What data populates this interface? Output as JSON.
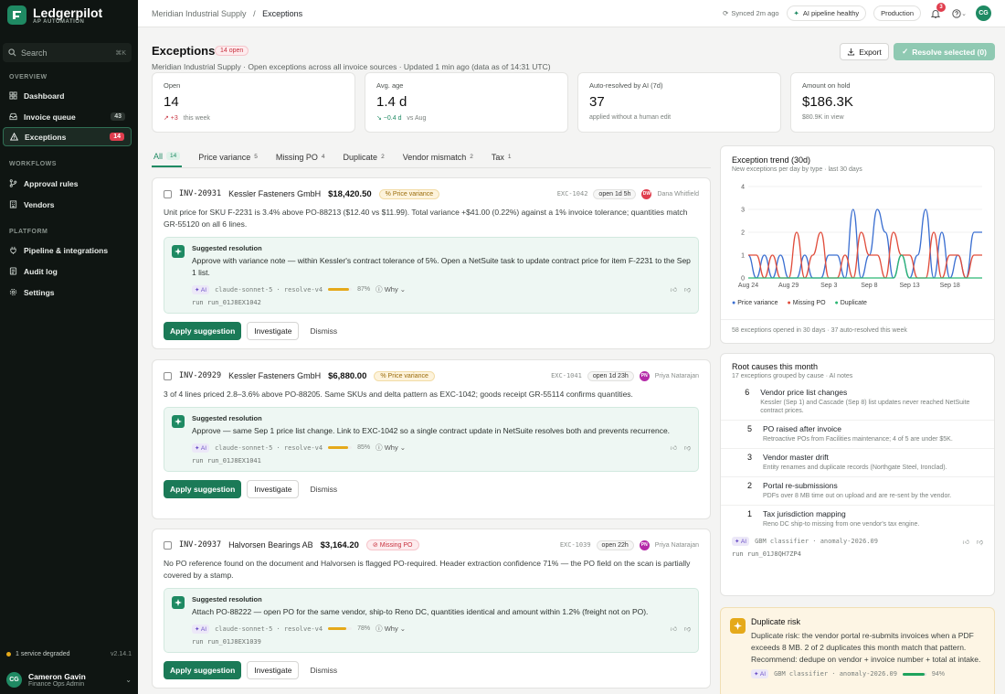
{
  "brand": {
    "name": "Ledgerpilot",
    "subtitle": "AP AUTOMATION"
  },
  "sidebar": {
    "search_placeholder": "Search",
    "search_shortcut": "⌘K",
    "sections": {
      "overview": "OVERVIEW",
      "workflows": "WORKFLOWS",
      "platform": "PLATFORM"
    },
    "items": [
      {
        "label": "Dashboard",
        "icon": "grid-icon"
      },
      {
        "label": "Invoice queue",
        "icon": "inbox-icon",
        "count": "43"
      },
      {
        "label": "Exceptions",
        "icon": "warning-icon",
        "count": "14",
        "active": true
      },
      {
        "label": "Approval rules",
        "icon": "branch-icon"
      },
      {
        "label": "Vendors",
        "icon": "building-icon"
      },
      {
        "label": "Pipeline & integrations",
        "icon": "plug-icon"
      },
      {
        "label": "Audit log",
        "icon": "log-icon"
      },
      {
        "label": "Settings",
        "icon": "gear-icon"
      }
    ],
    "status": "1 service degraded",
    "version": "v2.14.1",
    "user": {
      "initials": "CG",
      "name": "Cameron Gavin",
      "role": "Finance Ops Admin"
    }
  },
  "topbar": {
    "breadcrumb_org": "Meridian Industrial Supply",
    "breadcrumb_sep": "/",
    "breadcrumb_page": "Exceptions",
    "synced": "Synced 2m ago",
    "pipeline": "AI pipeline healthy",
    "env": "Production",
    "notifications": "3",
    "avatar": "CG"
  },
  "header": {
    "title": "Exceptions",
    "open_badge": "14 open",
    "subtitle": "Meridian Industrial Supply · Open exceptions across all invoice sources · Updated 1 min ago (data as of 14:31 UTC)",
    "export_label": "Export",
    "resolve_label": "Resolve selected (0)"
  },
  "kpis": [
    {
      "label": "Open",
      "value": "14",
      "delta": "↗ +3",
      "note": "this week"
    },
    {
      "label": "Avg. age",
      "value": "1.4 d",
      "delta": "↘ −0.4 d",
      "note": "vs Aug"
    },
    {
      "label": "Auto-resolved by AI (7d)",
      "value": "37",
      "note": "applied without a human edit"
    },
    {
      "label": "Amount on hold",
      "value": "$186.3K",
      "note": "$80.9K in view"
    }
  ],
  "tabs": [
    {
      "label": "All",
      "count": "14"
    },
    {
      "label": "Price variance",
      "count": "5"
    },
    {
      "label": "Missing PO",
      "count": "4"
    },
    {
      "label": "Duplicate",
      "count": "2"
    },
    {
      "label": "Vendor mismatch",
      "count": "2"
    },
    {
      "label": "Tax",
      "count": "1"
    }
  ],
  "cards": [
    {
      "invoice": "INV-20931",
      "vendor": "Kessler Fasteners GmbH",
      "amount": "$18,420.50",
      "tag": "Price variance",
      "exc": "EXC-1042",
      "age": "open 1d 5h",
      "assignee_initials": "DW",
      "assignee": "Dana Whitfield",
      "desc": "Unit price for SKU F-2231 is 3.4% above PO-88213 ($12.40 vs $11.99). Total variance +$41.00 (0.22%) against a 1% invoice tolerance; quantities match GR-55120 on all 6 lines.",
      "sugg_title": "Suggested resolution",
      "sugg": "Approve with variance note — within Kessler's contract tolerance of 5%. Open a NetSuite task to update contract price for item F-2231 to the Sep 1 list.",
      "ai": "AI",
      "model": "claude-sonnet-5 · resolve-v4",
      "conf": "87%",
      "conf_value": 0.87,
      "why": "Why",
      "run": "run_01J8EX1042"
    },
    {
      "invoice": "INV-20929",
      "vendor": "Kessler Fasteners GmbH",
      "amount": "$6,880.00",
      "tag": "Price variance",
      "exc": "EXC-1041",
      "age": "open 1d 23h",
      "assignee_initials": "PN",
      "assignee": "Priya Natarajan",
      "desc": "3 of 4 lines priced 2.8–3.6% above PO-88205. Same SKUs and delta pattern as EXC-1042; goods receipt GR-55114 confirms quantities.",
      "sugg_title": "Suggested resolution",
      "sugg": "Approve — same Sep 1 price list change. Link to EXC-1042 so a single contract update in NetSuite resolves both and prevents recurrence.",
      "ai": "AI",
      "model": "claude-sonnet-5 · resolve-v4",
      "conf": "85%",
      "conf_value": 0.85,
      "why": "Why",
      "run": "run_01J8EX1041"
    },
    {
      "invoice": "INV-20937",
      "vendor": "Halvorsen Bearings AB",
      "amount": "$3,164.20",
      "tag": "Missing PO",
      "exc": "EXC-1039",
      "age": "open 22h",
      "assignee_initials": "PN",
      "assignee": "Priya Natarajan",
      "desc": "No PO reference found on the document and Halvorsen is flagged PO-required. Header extraction confidence 71% — the PO field on the scan is partially covered by a stamp.",
      "sugg_title": "Suggested resolution",
      "sugg": "Attach PO-88222 — open PO for the same vendor, ship-to Reno DC, quantities identical and amount within 1.2% (freight not on PO).",
      "ai": "AI",
      "model": "claude-sonnet-5 · resolve-v4",
      "conf": "78%",
      "conf_value": 0.78,
      "why": "Why",
      "run": "run_01J8EX1039"
    }
  ],
  "actions": {
    "apply": "Apply suggestion",
    "investigate": "Investigate",
    "dismiss": "Dismiss"
  },
  "trend": {
    "title": "Exception trend (30d)",
    "subtitle": "New exceptions per day by type · last 30 days",
    "footer": "58 exceptions opened in 30 days · 37 auto-resolved this week"
  },
  "chart_data": {
    "type": "line",
    "x": [
      "Aug 24",
      "Aug 25",
      "Aug 26",
      "Aug 27",
      "Aug 28",
      "Aug 29",
      "Aug 30",
      "Aug 31",
      "Sep 1",
      "Sep 2",
      "Sep 3",
      "Sep 4",
      "Sep 5",
      "Sep 6",
      "Sep 7",
      "Sep 8",
      "Sep 9",
      "Sep 10",
      "Sep 11",
      "Sep 12",
      "Sep 13",
      "Sep 14",
      "Sep 15",
      "Sep 16",
      "Sep 17",
      "Sep 18",
      "Sep 19",
      "Sep 20",
      "Sep 21",
      "Sep 22"
    ],
    "xticks": [
      "Aug 24",
      "Aug 29",
      "Sep 3",
      "Sep 8",
      "Sep 13",
      "Sep 18"
    ],
    "yticks": [
      "0",
      "1",
      "2",
      "3",
      "4"
    ],
    "ylim": [
      0,
      4
    ],
    "grid": true,
    "legend": "bottom",
    "series": [
      {
        "name": "Price variance",
        "color": "#3b6fd1",
        "values": [
          1,
          0,
          1,
          0,
          1,
          0,
          0,
          1,
          0,
          0,
          1,
          1,
          0,
          3,
          0,
          1,
          3,
          2,
          0,
          1,
          0,
          1,
          3,
          0,
          2,
          0,
          1,
          0,
          2,
          2
        ]
      },
      {
        "name": "Missing PO",
        "color": "#e04c3b",
        "values": [
          1,
          1,
          0,
          1,
          0,
          0,
          2,
          0,
          1,
          2,
          0,
          0,
          1,
          0,
          2,
          1,
          1,
          0,
          2,
          1,
          1,
          0,
          0,
          2,
          0,
          1,
          1,
          0,
          1,
          1
        ]
      },
      {
        "name": "Duplicate",
        "color": "#2bb673",
        "values": [
          0,
          0,
          0,
          0,
          0,
          0,
          0,
          0,
          0,
          0,
          0,
          0,
          0,
          0,
          0,
          0,
          0,
          0,
          0,
          1,
          0,
          0,
          0,
          0,
          0,
          0,
          0,
          0,
          0,
          0
        ]
      }
    ]
  },
  "root_causes": {
    "title": "Root causes this month",
    "subtitle": "17 exceptions grouped by cause · AI notes",
    "items": [
      {
        "count": "6",
        "title": "Vendor price list changes",
        "desc": "Kessler (Sep 1) and Cascade (Sep 8) list updates never reached NetSuite contract prices."
      },
      {
        "count": "5",
        "title": "PO raised after invoice",
        "desc": "Retroactive POs from Facilities maintenance; 4 of 5 are under $5K."
      },
      {
        "count": "3",
        "title": "Vendor master drift",
        "desc": "Entity renames and duplicate records (Northgate Steel, Ironclad)."
      },
      {
        "count": "2",
        "title": "Portal re-submissions",
        "desc": "PDFs over 8 MB time out on upload and are re-sent by the vendor."
      },
      {
        "count": "1",
        "title": "Tax jurisdiction mapping",
        "desc": "Reno DC ship-to missing from one vendor's tax engine."
      }
    ],
    "ai": "AI",
    "model": "GBM classifier · anomaly-2026.09",
    "run": "run_01J8QH7ZP4"
  },
  "duplicate_risk": {
    "title": "Duplicate risk",
    "text": "Duplicate risk: the vendor portal re-submits invoices when a PDF exceeds 8 MB. 2 of 2 duplicates this month match that pattern. Recommend: dedupe on vendor + invoice number + total at intake.",
    "ai": "AI",
    "model": "GBM classifier · anomaly-2026.09",
    "conf": "94%",
    "conf_value": 0.94
  }
}
